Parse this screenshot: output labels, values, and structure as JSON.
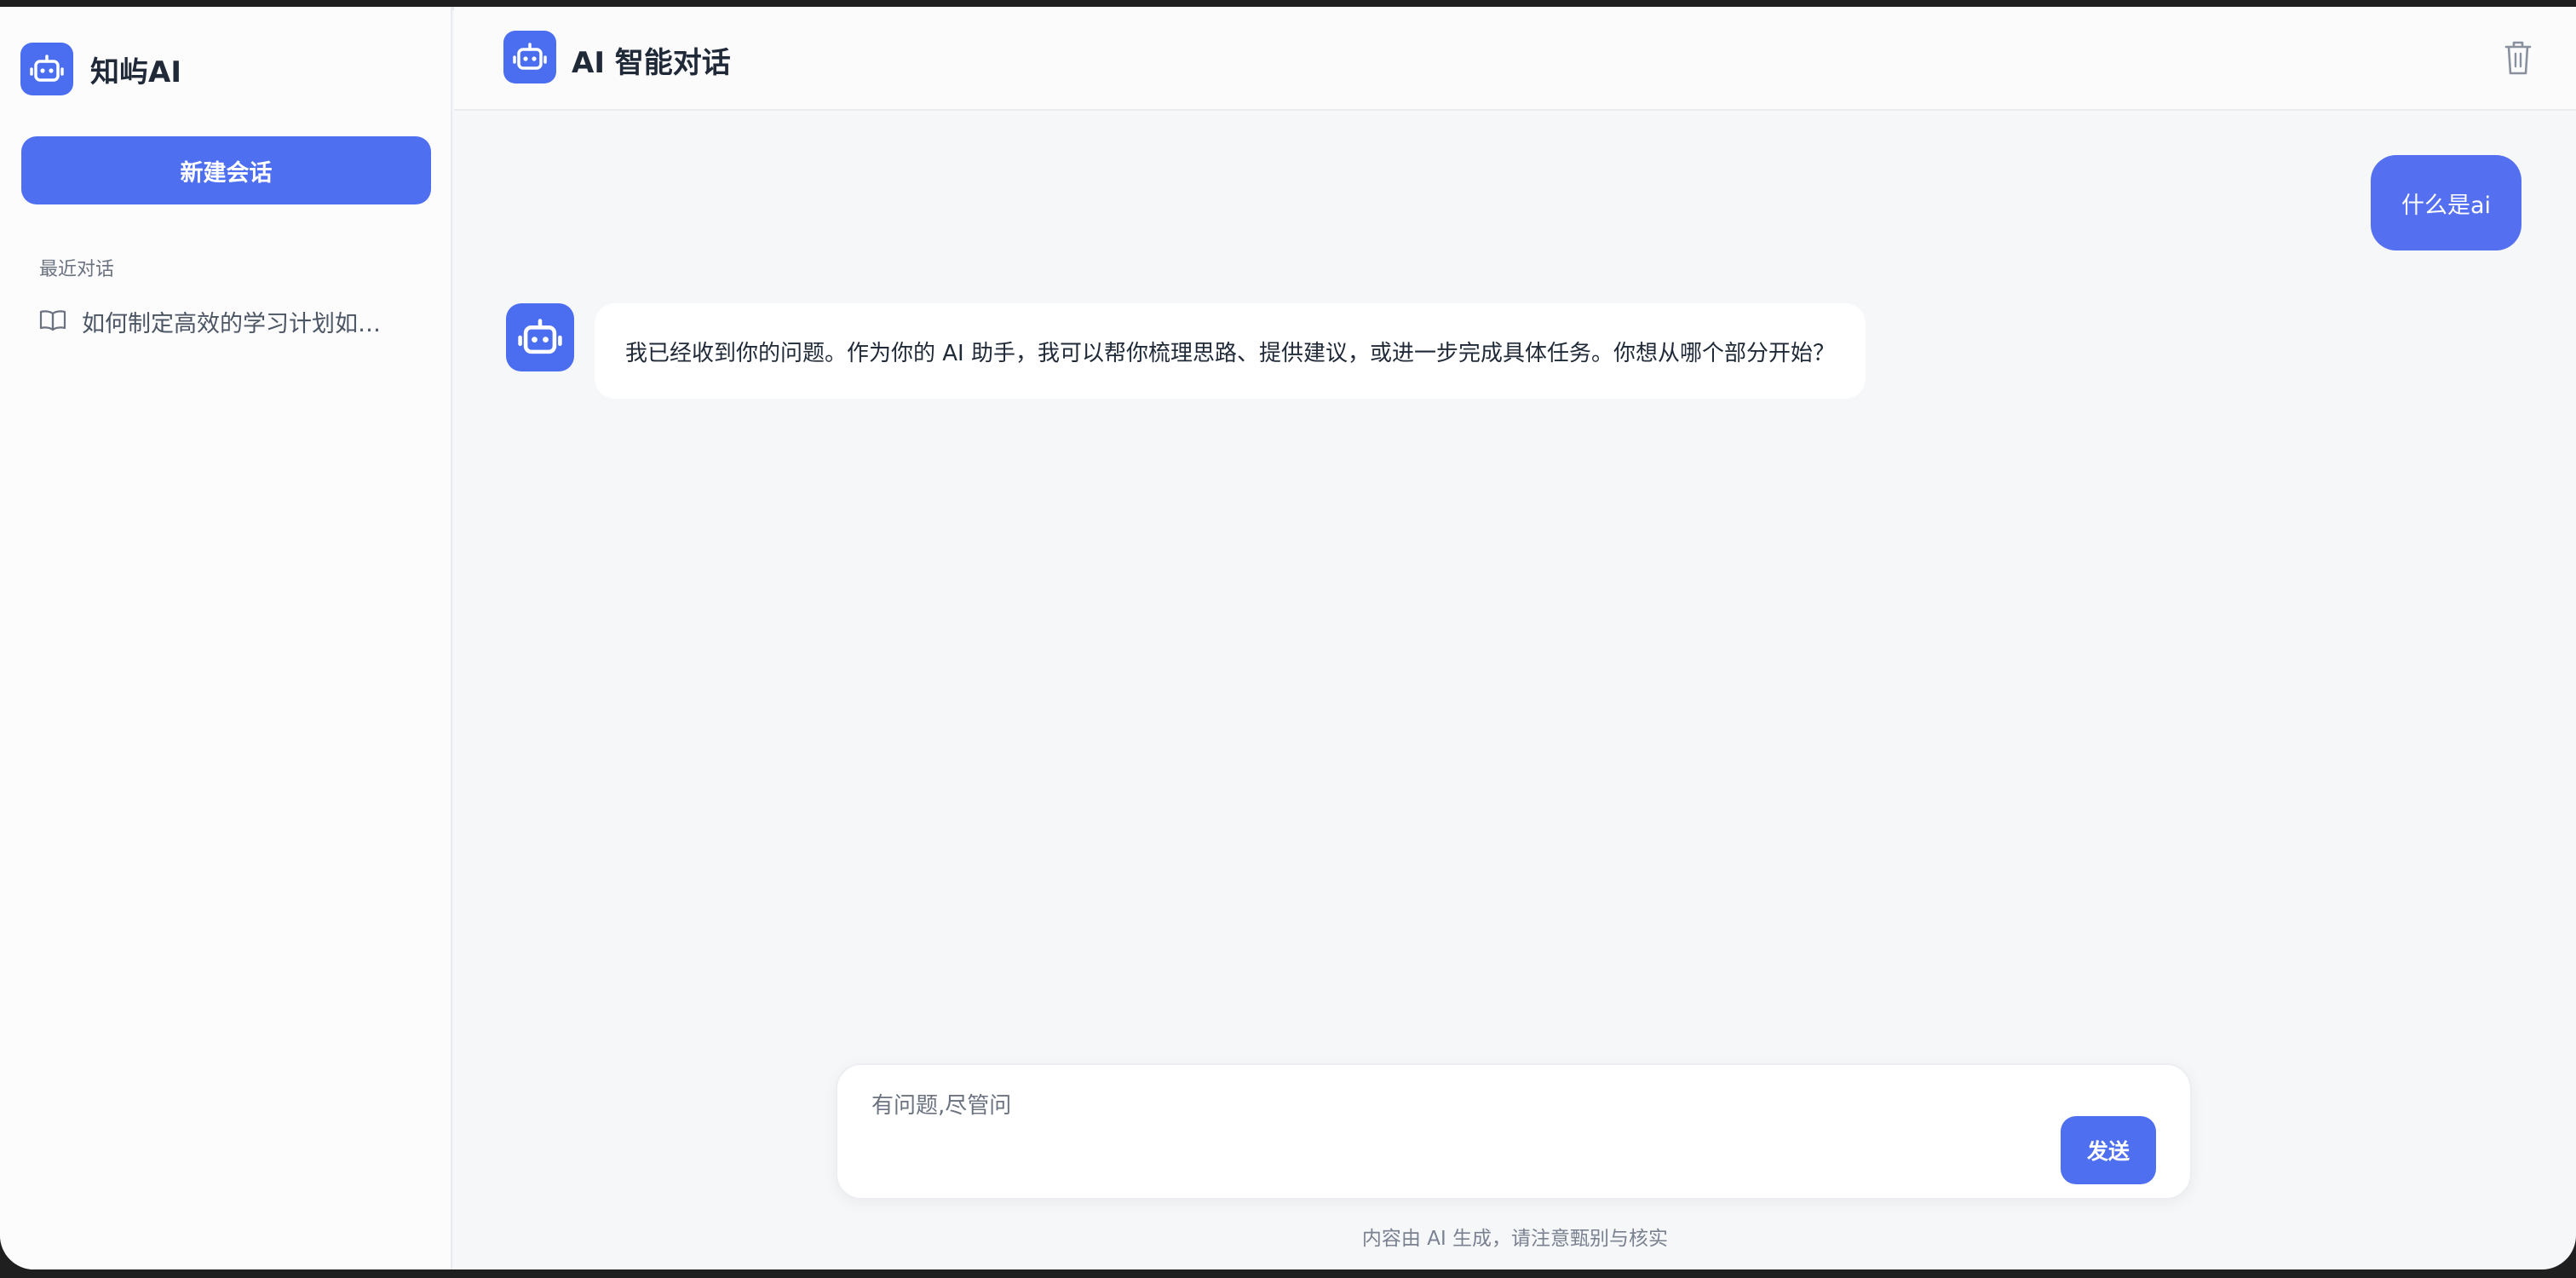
{
  "sidebar": {
    "brand_name": "知屿AI",
    "new_chat_label": "新建会话",
    "recent_label": "最近对话",
    "recent_items": [
      {
        "label": "如何制定高效的学习计划如…"
      }
    ]
  },
  "header": {
    "title": "AI 智能对话"
  },
  "messages": {
    "user_text": "什么是ai",
    "ai_text": "我已经收到你的问题。作为你的 AI 助手，我可以帮你梳理思路、提供建议，或进一步完成具体任务。你想从哪个部分开始？"
  },
  "composer": {
    "placeholder": "有问题,尽管问",
    "value": "",
    "send_label": "发送"
  },
  "footer": {
    "disclaimer": "内容由 AI 生成，请注意甄别与核实"
  },
  "colors": {
    "accent": "#4f6ff1",
    "page_bg": "#f6f7f9",
    "sidebar_bg": "#fcfcfd"
  },
  "icons": {
    "brand": "robot-icon",
    "recent_item": "book-open-icon",
    "clear": "trash-icon"
  }
}
